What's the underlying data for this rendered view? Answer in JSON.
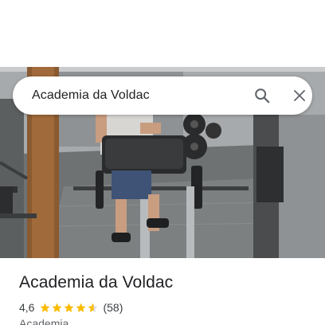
{
  "search": {
    "query": "Academia da Voldac"
  },
  "place": {
    "name": "Academia da Voldac",
    "rating_value": "4,6",
    "rating": 4.6,
    "max_rating": 5,
    "review_count": "(58)",
    "category": "Academia"
  },
  "colors": {
    "star": "#fbbc04",
    "text_primary": "#202124",
    "text_secondary": "#5f6368",
    "icon": "#5f6368"
  },
  "icons": {
    "search": "search-icon",
    "clear": "close-icon",
    "star": "star-icon"
  }
}
